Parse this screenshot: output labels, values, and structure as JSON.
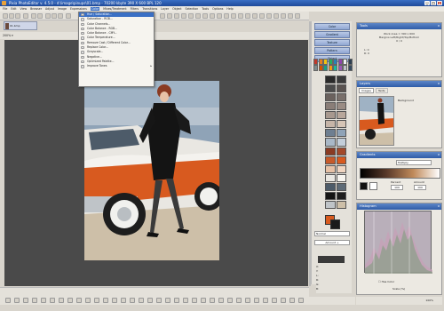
{
  "window": {
    "title": "Pixia PhotoEditor v. 4.5.0 - d:\\image\\pinups\\01.bmp - 70200 kbyte  390 X 600 BPL 120",
    "minimize": "_",
    "maximize": "□",
    "close": "x"
  },
  "menu": [
    "File",
    "Edit",
    "View",
    "Browser",
    "Adjust",
    "Image",
    "Expressions",
    "Color",
    "Mixes/Treatment",
    "Filters",
    "Transitions",
    "Layer",
    "Object",
    "Selection",
    "Tools",
    "Options",
    "Help"
  ],
  "thumb_tab": {
    "label": "01.bmp"
  },
  "zoom": {
    "value": "200%"
  },
  "dropdown": {
    "items": [
      {
        "label": "Hue / Saturation...",
        "highlighted": true,
        "submenu": false
      },
      {
        "label": "Saturation - RGB...",
        "highlighted": false,
        "submenu": false
      },
      {
        "label": "Color Channels...",
        "highlighted": false,
        "submenu": false
      },
      {
        "label": "Color Balance - RGB...",
        "highlighted": false,
        "submenu": false
      },
      {
        "label": "Color Balance - CMY...",
        "highlighted": false,
        "submenu": false
      },
      {
        "label": "Color Temperature...",
        "highlighted": false,
        "submenu": false
      },
      {
        "label": "Remove Cast / Different Color...",
        "highlighted": false,
        "submenu": false
      },
      {
        "label": "Replace Color...",
        "highlighted": false,
        "submenu": false
      },
      {
        "label": "Grayscale...",
        "highlighted": false,
        "submenu": false
      },
      {
        "label": "Negative...",
        "highlighted": false,
        "submenu": false
      },
      {
        "label": "Optimized Palette...",
        "highlighted": false,
        "submenu": false
      },
      {
        "label": "Improve Tones",
        "highlighted": false,
        "submenu": true
      }
    ]
  },
  "side_buttons": [
    "Color",
    "Gradient",
    "Texture",
    "Pattern",
    "Object"
  ],
  "blend": {
    "mode": "Normal",
    "amount": "Amount +"
  },
  "coords": [
    "X:",
    "Y:",
    "L:",
    "R:",
    "G:",
    "B:"
  ],
  "panels": {
    "tools": {
      "title": "Tools",
      "line1": "Work Area = 390 x 600",
      "line2": "Margins Left/Right/Top/Bottom",
      "line3": "0 / 0",
      "line4": "L: 0",
      "line5": "R: 0"
    },
    "layers": {
      "title": "Layers",
      "tab_images": "Images",
      "tab_texts": "Texts",
      "layer_name": "Background"
    },
    "gradients": {
      "title": "Gradients",
      "mode": "Multiply",
      "percent_label": "Percent",
      "amount_label": "Amount",
      "percent": "100",
      "amount": "100"
    },
    "histogram": {
      "title": "Histogram",
      "has_color_label": "Has Color",
      "scale_label": "Scale (%)"
    }
  },
  "status": {
    "zoom": "100%"
  },
  "colors": {
    "accent": "#3a6fc4",
    "canvas": "#4a4a4a",
    "panel": "#ece9e2"
  }
}
